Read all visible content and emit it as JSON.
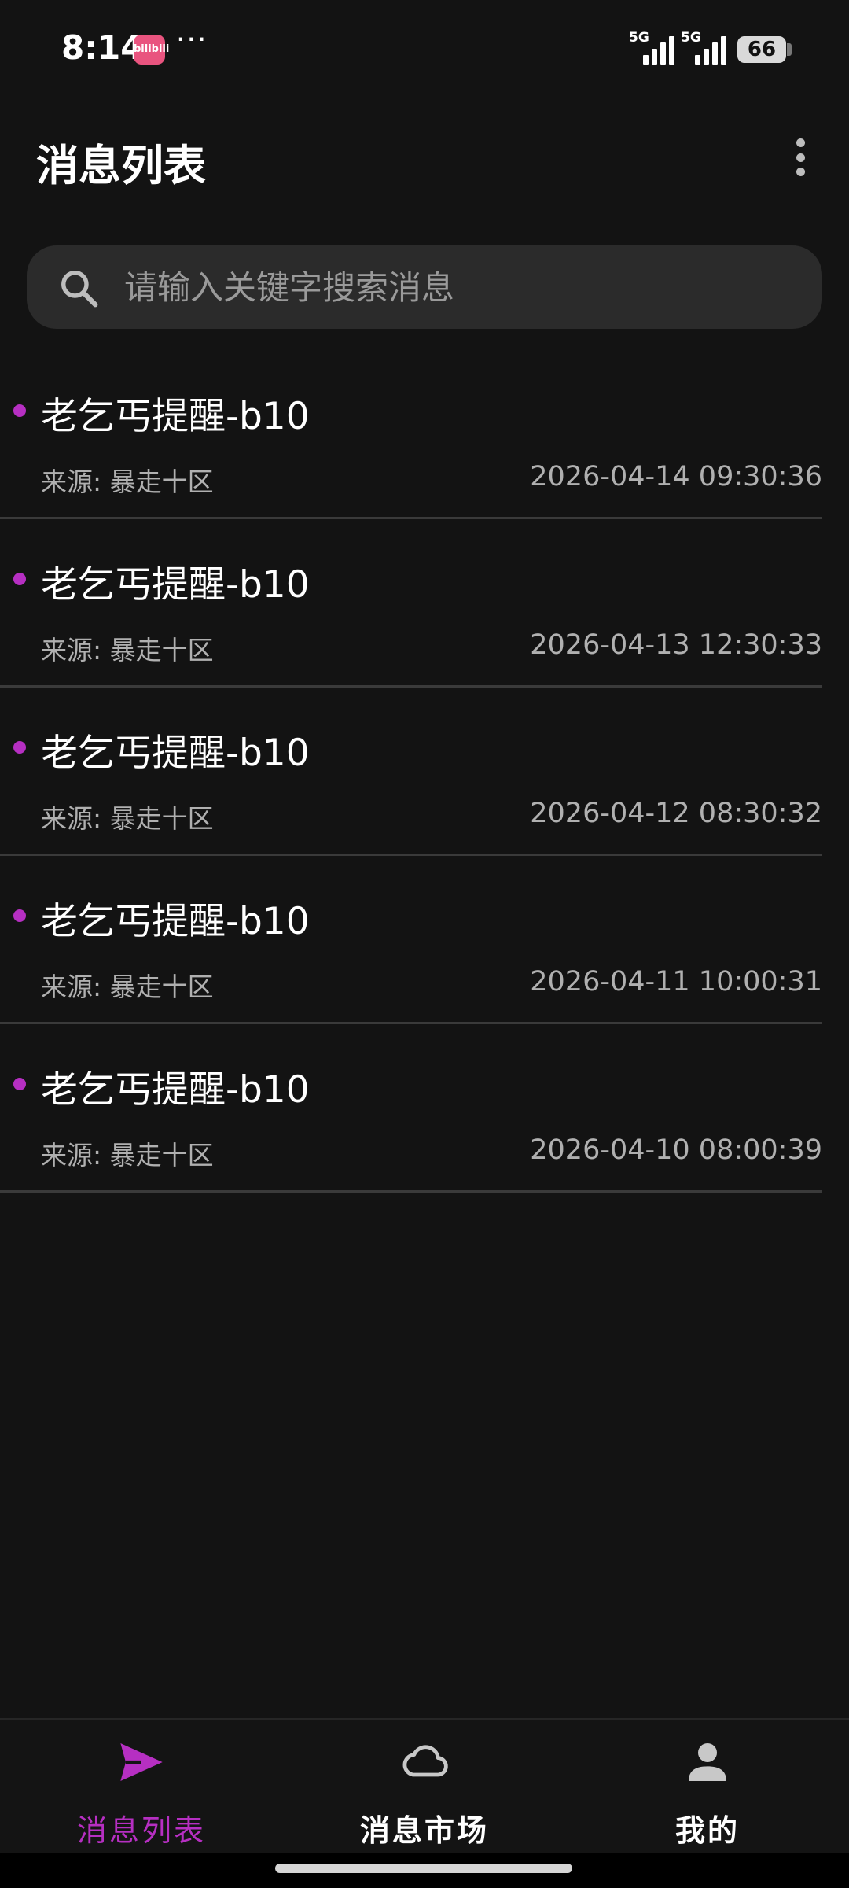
{
  "status_bar": {
    "time": "8:14",
    "app_badge": "bilibili",
    "more": "···",
    "signal_1": "5G",
    "signal_2": "5G",
    "battery": "66"
  },
  "header": {
    "title": "消息列表",
    "menu_icon": "more-vertical-icon"
  },
  "search": {
    "placeholder": "请输入关键字搜索消息",
    "value": ""
  },
  "messages": [
    {
      "title": "老乞丐提醒-b10",
      "source": "来源: 暴走十区",
      "time": "2026-04-14 09:30:36",
      "unread": true
    },
    {
      "title": "老乞丐提醒-b10",
      "source": "来源: 暴走十区",
      "time": "2026-04-13 12:30:33",
      "unread": true
    },
    {
      "title": "老乞丐提醒-b10",
      "source": "来源: 暴走十区",
      "time": "2026-04-12 08:30:32",
      "unread": true
    },
    {
      "title": "老乞丐提醒-b10",
      "source": "来源: 暴走十区",
      "time": "2026-04-11 10:00:31",
      "unread": true
    },
    {
      "title": "老乞丐提醒-b10",
      "source": "来源: 暴走十区",
      "time": "2026-04-10 08:00:39",
      "unread": true
    }
  ],
  "bottom_nav": {
    "active": "messages",
    "items": [
      {
        "label": "消息列表",
        "icon": "send-icon"
      },
      {
        "label": "消息市场",
        "icon": "cloud-icon"
      },
      {
        "label": "我的",
        "icon": "person-icon"
      }
    ]
  },
  "colors": {
    "background": "#131313",
    "accent": "#b62fc2",
    "search_bg": "#2b2b2b",
    "secondary_text": "#b0b0b0"
  }
}
